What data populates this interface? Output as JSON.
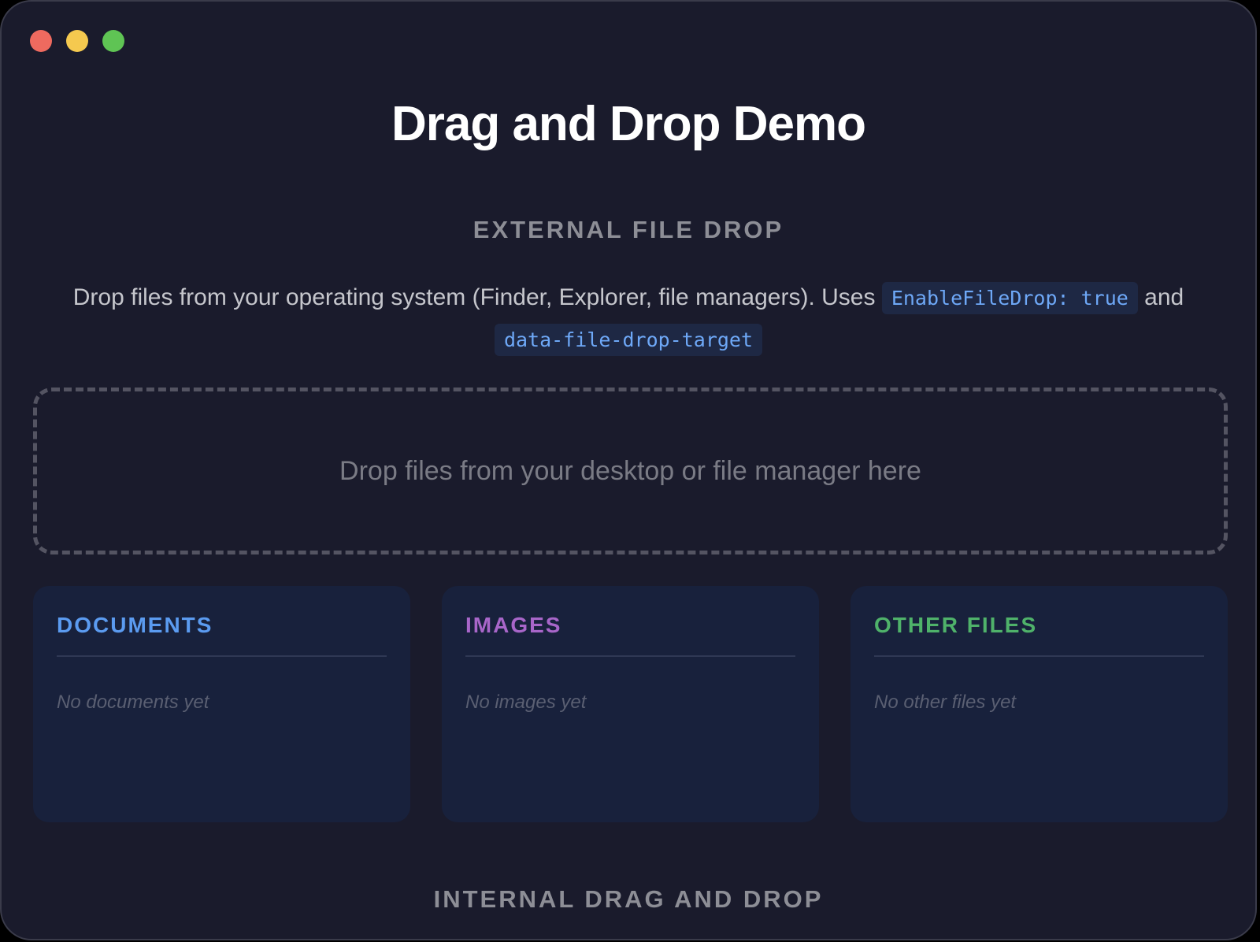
{
  "window": {
    "traffic_lights": [
      {
        "name": "close",
        "color": "#ee6a5f"
      },
      {
        "name": "minimize",
        "color": "#f5c94f"
      },
      {
        "name": "maximize",
        "color": "#5fc454"
      }
    ]
  },
  "title": "Drag and Drop Demo",
  "external": {
    "heading": "EXTERNAL FILE DROP",
    "description_prefix": "Drop files from your operating system (Finder, Explorer, file managers). Uses ",
    "code_1": "EnableFileDrop: true",
    "description_middle": " and ",
    "code_2": "data-file-drop-target",
    "drop_zone_text": "Drop files from your desktop or file manager here"
  },
  "cards": [
    {
      "title": "DOCUMENTS",
      "empty_text": "No documents yet",
      "color": "#5b9bf0"
    },
    {
      "title": "IMAGES",
      "empty_text": "No images yet",
      "color": "#a866c9"
    },
    {
      "title": "OTHER FILES",
      "empty_text": "No other files yet",
      "color": "#4fb26a"
    }
  ],
  "internal": {
    "heading": "INTERNAL DRAG AND DROP"
  },
  "colors": {
    "background": "#1a1b2c",
    "card_background": "#18213c",
    "code_text": "#6ea8f7",
    "code_background": "#1e2844"
  }
}
